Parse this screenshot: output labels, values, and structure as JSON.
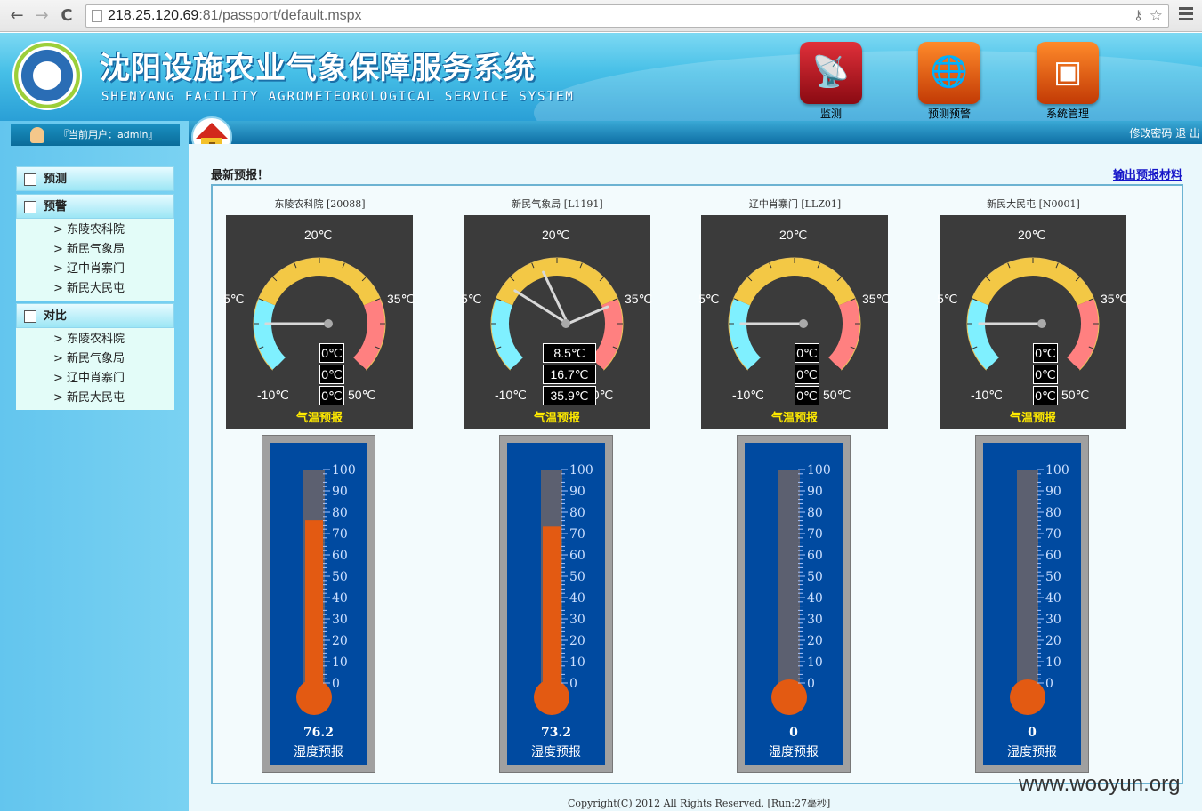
{
  "browser": {
    "url_host": "218.25.120.69",
    "url_rest": ":81/passport/default.mspx",
    "back": "←",
    "forward": "→",
    "reload": "C"
  },
  "header": {
    "title_cn": "沈阳设施农业气象保障服务系统",
    "title_en": "SHENYANG FACILITY AGROMETEOROLOGICAL SERVICE SYSTEM",
    "buttons": [
      {
        "label": "监测",
        "icon": "satellite-dish-icon",
        "color": "#b0121e"
      },
      {
        "label": "预测预警",
        "icon": "globe-icon",
        "color": "#e8500c"
      },
      {
        "label": "系统管理",
        "icon": "chip-icon",
        "color": "#e8500c"
      }
    ]
  },
  "user": {
    "text": "『当前用户：admin』"
  },
  "topbar": {
    "links": "修改密码  退  出"
  },
  "leftmenu": [
    {
      "label": "预测",
      "items": []
    },
    {
      "label": "预警",
      "items": [
        "> 东陵农科院",
        "> 新民气象局",
        "> 辽中肖寨门",
        "> 新民大民屯"
      ]
    },
    {
      "label": "对比",
      "items": [
        "> 东陵农科院",
        "> 新民气象局",
        "> 辽中肖寨门",
        "> 新民大民屯"
      ]
    }
  ],
  "content": {
    "title": "最新预报！",
    "export_link": "输出预报材料"
  },
  "gauge_labels": {
    "min": "-10℃",
    "left": "5℃",
    "top": "20℃",
    "right": "35℃",
    "max": "50℃",
    "caption": "气温预报"
  },
  "thermo_ticks": [
    "100",
    "90",
    "80",
    "70",
    "60",
    "50",
    "40",
    "30",
    "20",
    "10",
    "0"
  ],
  "thermo_caption": "湿度预报",
  "stations": [
    {
      "name": "东陵农科院 [20088]",
      "temps": [
        "0℃",
        "0℃",
        "0℃"
      ],
      "temp_values": [
        0,
        0,
        0
      ],
      "humidity": 76.2,
      "humidity_text": "76.2"
    },
    {
      "name": "新民气象局 [L1191]",
      "temps": [
        "8.5℃",
        "16.7℃",
        "35.9℃"
      ],
      "temp_values": [
        8.5,
        16.7,
        35.9
      ],
      "humidity": 73.2,
      "humidity_text": "73.2"
    },
    {
      "name": "辽中肖寨门 [LLZ01]",
      "temps": [
        "0℃",
        "0℃",
        "0℃"
      ],
      "temp_values": [
        0,
        0,
        0
      ],
      "humidity": 0,
      "humidity_text": "0"
    },
    {
      "name": "新民大民屯 [N0001]",
      "temps": [
        "0℃",
        "0℃",
        "0℃"
      ],
      "temp_values": [
        0,
        0,
        0
      ],
      "humidity": 0,
      "humidity_text": "0"
    }
  ],
  "footer": {
    "copyright": "Copyright(C) 2012 All Rights Reserved. [Run:27毫秒]",
    "watermark": "www.wooyun.org"
  }
}
